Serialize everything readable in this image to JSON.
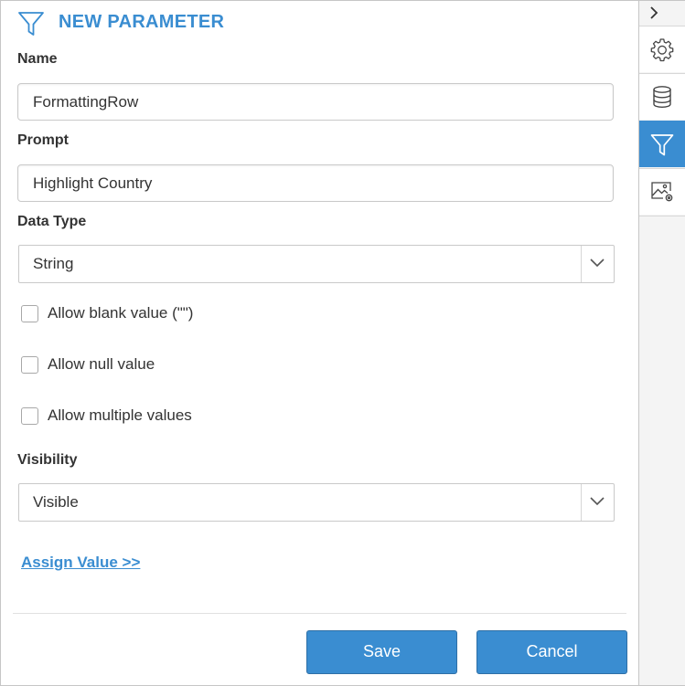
{
  "panel": {
    "title": "NEW PARAMETER",
    "title_icon": "filter-icon"
  },
  "form": {
    "name": {
      "label": "Name",
      "value": "FormattingRow"
    },
    "prompt": {
      "label": "Prompt",
      "value": "Highlight Country"
    },
    "data_type": {
      "label": "Data Type",
      "selected": "String"
    },
    "options": [
      {
        "label": "Allow blank value (\"\")",
        "checked": false
      },
      {
        "label": "Allow null value",
        "checked": false
      },
      {
        "label": "Allow multiple values",
        "checked": false
      }
    ],
    "visibility": {
      "label": "Visibility",
      "selected": "Visible"
    },
    "assign_link": "Assign Value >>"
  },
  "footer": {
    "save_label": "Save",
    "cancel_label": "Cancel"
  },
  "sidebar": {
    "collapse_icon": "chevron-right-icon",
    "items": [
      {
        "icon": "gear-icon",
        "active": false
      },
      {
        "icon": "database-icon",
        "active": false
      },
      {
        "icon": "filter-icon",
        "active": true
      },
      {
        "icon": "image-settings-icon",
        "active": false
      }
    ]
  },
  "colors": {
    "accent": "#3a8dd1",
    "text": "#333333",
    "border": "#c9c9c9"
  }
}
